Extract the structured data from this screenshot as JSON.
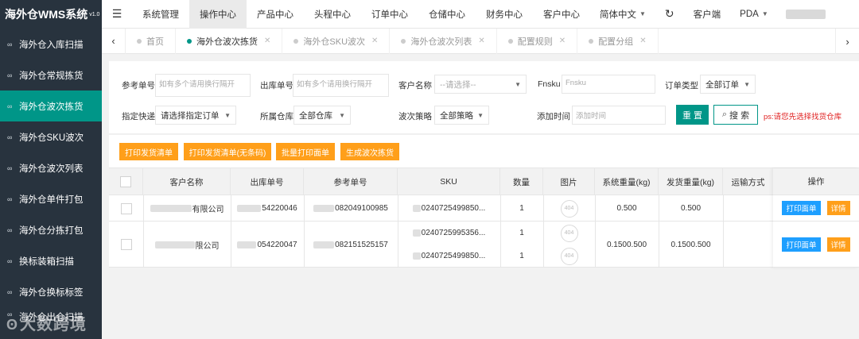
{
  "app": {
    "logo": "海外仓WMS系统",
    "version": "v1.0"
  },
  "sidebar": {
    "items": [
      {
        "label": "海外仓入库扫描",
        "active": false
      },
      {
        "label": "海外仓常规拣货",
        "active": false
      },
      {
        "label": "海外仓波次拣货",
        "active": true
      },
      {
        "label": "海外仓SKU波次",
        "active": false
      },
      {
        "label": "海外仓波次列表",
        "active": false
      },
      {
        "label": "海外仓单件打包",
        "active": false
      },
      {
        "label": "海外仓分拣打包",
        "active": false
      },
      {
        "label": "换标装箱扫描",
        "active": false
      },
      {
        "label": "海外仓换标标签",
        "active": false
      },
      {
        "label": "海外仓出仓扫描",
        "active": false
      }
    ],
    "watermark": "大数跨境"
  },
  "topnav": {
    "items": [
      "系统管理",
      "操作中心",
      "产品中心",
      "头程中心",
      "订单中心",
      "仓储中心",
      "财务中心",
      "客户中心"
    ],
    "active_index": 1,
    "language": "简体中文",
    "client": "客户端",
    "pda": "PDA"
  },
  "tabs": [
    {
      "label": "首页",
      "active": false,
      "closable": false
    },
    {
      "label": "海外仓波次拣货",
      "active": true,
      "closable": true
    },
    {
      "label": "海外仓SKU波次",
      "active": false,
      "closable": true
    },
    {
      "label": "海外仓波次列表",
      "active": false,
      "closable": true
    },
    {
      "label": "配置规则",
      "active": false,
      "closable": true
    },
    {
      "label": "配置分组",
      "active": false,
      "closable": true
    }
  ],
  "filters": {
    "ref_no": {
      "label": "参考单号",
      "placeholder": "如有多个请用换行隔开"
    },
    "outbound_no": {
      "label": "出库单号",
      "placeholder": "如有多个请用换行隔开"
    },
    "customer": {
      "label": "客户名称",
      "placeholder": "--请选择--"
    },
    "fnsku": {
      "label": "Fnsku",
      "placeholder": "Fnsku"
    },
    "order_type": {
      "label": "订单类型",
      "value": "全部订单"
    },
    "express": {
      "label": "指定快递",
      "value": "请选择指定订单"
    },
    "warehouse": {
      "label": "所属仓库",
      "value": "全部仓库"
    },
    "strategy": {
      "label": "波次策略",
      "value": "全部策略"
    },
    "add_time": {
      "label": "添加时间",
      "placeholder": "添加时间"
    },
    "reset": "重 置",
    "search": "搜 索",
    "note": "ps:请您先选择找货仓库"
  },
  "actions": [
    "打印发货清单",
    "打印发货清单(无条码)",
    "批量打印面单",
    "生成波次拣货"
  ],
  "table": {
    "columns": [
      "客户名称",
      "出库单号",
      "参考单号",
      "SKU",
      "数量",
      "图片",
      "系统重量(kg)",
      "发货重量(kg)",
      "运输方式",
      "操作"
    ],
    "rows": [
      {
        "customer": "有限公司",
        "outbound": "54220046",
        "ref": "082049100985",
        "skus": [
          {
            "sku": "0240725499850...",
            "qty": "1",
            "img": "404"
          }
        ],
        "sys_weight": "0.500",
        "ship_weight": "0.500",
        "transport": ""
      },
      {
        "customer": "限公司",
        "outbound": "054220047",
        "ref": "082151525157",
        "skus": [
          {
            "sku": "0240725995356...",
            "qty": "1",
            "img": "404"
          },
          {
            "sku": "0240725499850...",
            "qty": "1",
            "img": "404"
          }
        ],
        "sys_weight": "0.1500.500",
        "ship_weight": "0.1500.500",
        "transport": ""
      }
    ],
    "ops": {
      "print": "打印面单",
      "detail": "详情"
    }
  }
}
